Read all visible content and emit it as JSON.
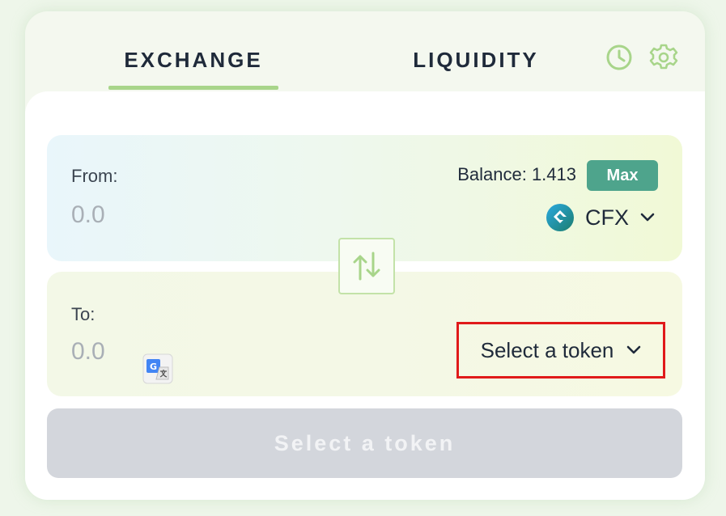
{
  "tabs": {
    "exchange": "EXCHANGE",
    "liquidity": "LIQUIDITY",
    "active": "exchange"
  },
  "header_icons": [
    "clock-icon",
    "gear-icon"
  ],
  "from": {
    "label": "From:",
    "amount_placeholder": "0.0",
    "balance_label": "Balance: 1.413",
    "max_label": "Max",
    "token": "CFX"
  },
  "to": {
    "label": "To:",
    "amount_placeholder": "0.0",
    "select_label": "Select a token"
  },
  "submit_label": "Select a token",
  "colors": {
    "accent_green": "#a8d58a",
    "max_button": "#4ea48c",
    "highlight_border": "#e01a1a",
    "disabled_button": "#d3d6dc"
  }
}
